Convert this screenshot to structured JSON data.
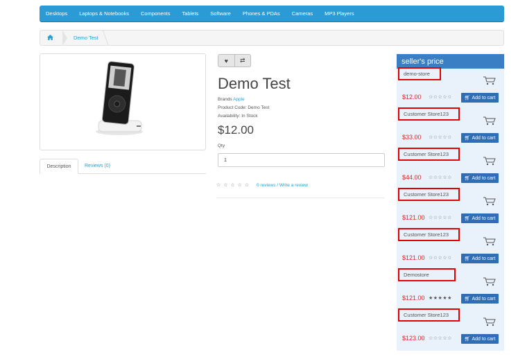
{
  "menu": [
    "Desktops",
    "Laptops & Notebooks",
    "Components",
    "Tablets",
    "Software",
    "Phones & PDAs",
    "Cameras",
    "MP3 Players"
  ],
  "breadcrumb": {
    "home_icon": "home-icon",
    "current": "Demo Test"
  },
  "product": {
    "title": "Demo Test",
    "brand_label": "Brands",
    "brand": "Apple",
    "code": "Product Code: Demo Test",
    "availability": "Availability: In Stock",
    "price": "$12.00",
    "qty_label": "Qty",
    "qty_value": "1",
    "rating_stars": "☆ ☆ ☆ ☆ ☆",
    "reviews_link": "0 reviews / Write a review"
  },
  "tabs": {
    "description": "Description",
    "reviews": "Reviews (0)"
  },
  "seller_panel": {
    "title": "seller's price",
    "add_label": "Add to cart",
    "stores": [
      {
        "name": "demo-store",
        "price": "$12.00",
        "stars": "☆☆☆☆☆",
        "rating": 0
      },
      {
        "name": "Customer Store123",
        "price": "$33.00",
        "stars": "☆☆☆☆☆",
        "rating": 0
      },
      {
        "name": "Customer Store123",
        "price": "$44.00",
        "stars": "☆☆☆☆☆",
        "rating": 0
      },
      {
        "name": "Customer Store123",
        "price": "$121.00",
        "stars": "☆☆☆☆☆",
        "rating": 0
      },
      {
        "name": "Customer Store123",
        "price": "$121.00",
        "stars": "☆☆☆☆☆",
        "rating": 0
      },
      {
        "name": "Demostore",
        "price": "$121.00",
        "stars": "★★★★★",
        "rating": 5
      },
      {
        "name": "Customer Store123",
        "price": "$123.00",
        "stars": "☆☆☆☆☆",
        "rating": 0
      }
    ]
  },
  "colors": {
    "menu": "#2b9bd6",
    "panel_head": "#3a7fc4",
    "panel_bg": "#e9f1fb",
    "price_red": "#e0262b",
    "highlight": "#e00000"
  }
}
